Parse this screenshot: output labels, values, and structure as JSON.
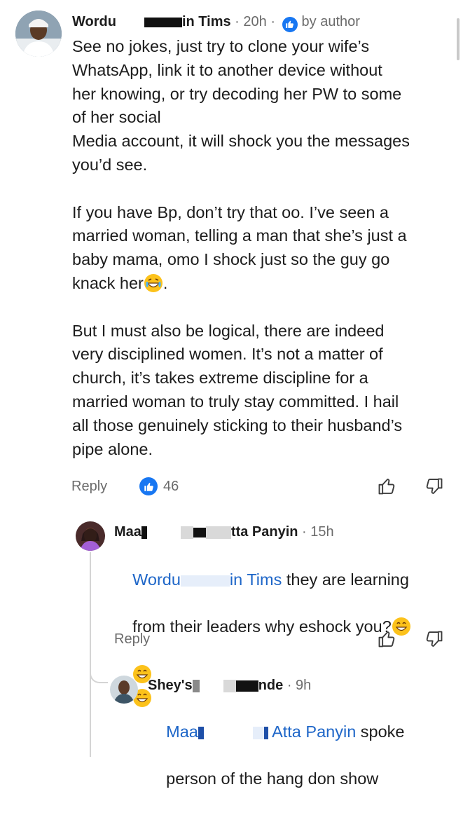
{
  "comments": [
    {
      "author_left": "Wordu",
      "author_right": "in Tims",
      "time": "· 20h ·",
      "by_author": "by author",
      "body": [
        "See no jokes, just try to clone your wife’s",
        "WhatsApp, link it to another device without",
        "her knowing, or try decoding her PW to some",
        "of her social",
        "Media account, it will shock you the messages",
        "you’d see.",
        "",
        "If you have Bp, don’t try that oo. I’ve seen a",
        "married woman, telling a man that she’s just a",
        "baby mama, omo I shock just so the guy go",
        "knack her",
        "",
        "But I must also be logical, there are indeed",
        "very disciplined women. It’s not a matter of",
        "church, it’s takes extreme discipline for a",
        "married woman to truly stay committed. I hail",
        "all those genuinely sticking to their husband’s",
        "pipe alone."
      ],
      "body_period": ".",
      "reply_label": "Reply",
      "likes": "46"
    },
    {
      "author_left": "Maa",
      "author_right": "tta Panyin",
      "time": "· 15h",
      "mention_left": "Wordu",
      "mention_right": "in Tims",
      "body_line1": "they are learning",
      "body_line2": "from their leaders why eshock you?",
      "reply_label": "Reply"
    },
    {
      "author_left": "Shey's",
      "author_right": "nde",
      "time": "· 9h",
      "mention_left": "Maa",
      "mention_right": "Atta Panyin",
      "body_line1": "spoke",
      "body_line2": "person of the hang don show"
    }
  ],
  "colors": {
    "accent": "#1877f2",
    "mention": "#1e66c8",
    "meta": "#6b6b6b"
  },
  "icons": [
    "like-badge-icon",
    "thumbs-up-icon",
    "thumbs-down-icon",
    "laughing-emoji-icon",
    "grinning-emoji-icon"
  ]
}
